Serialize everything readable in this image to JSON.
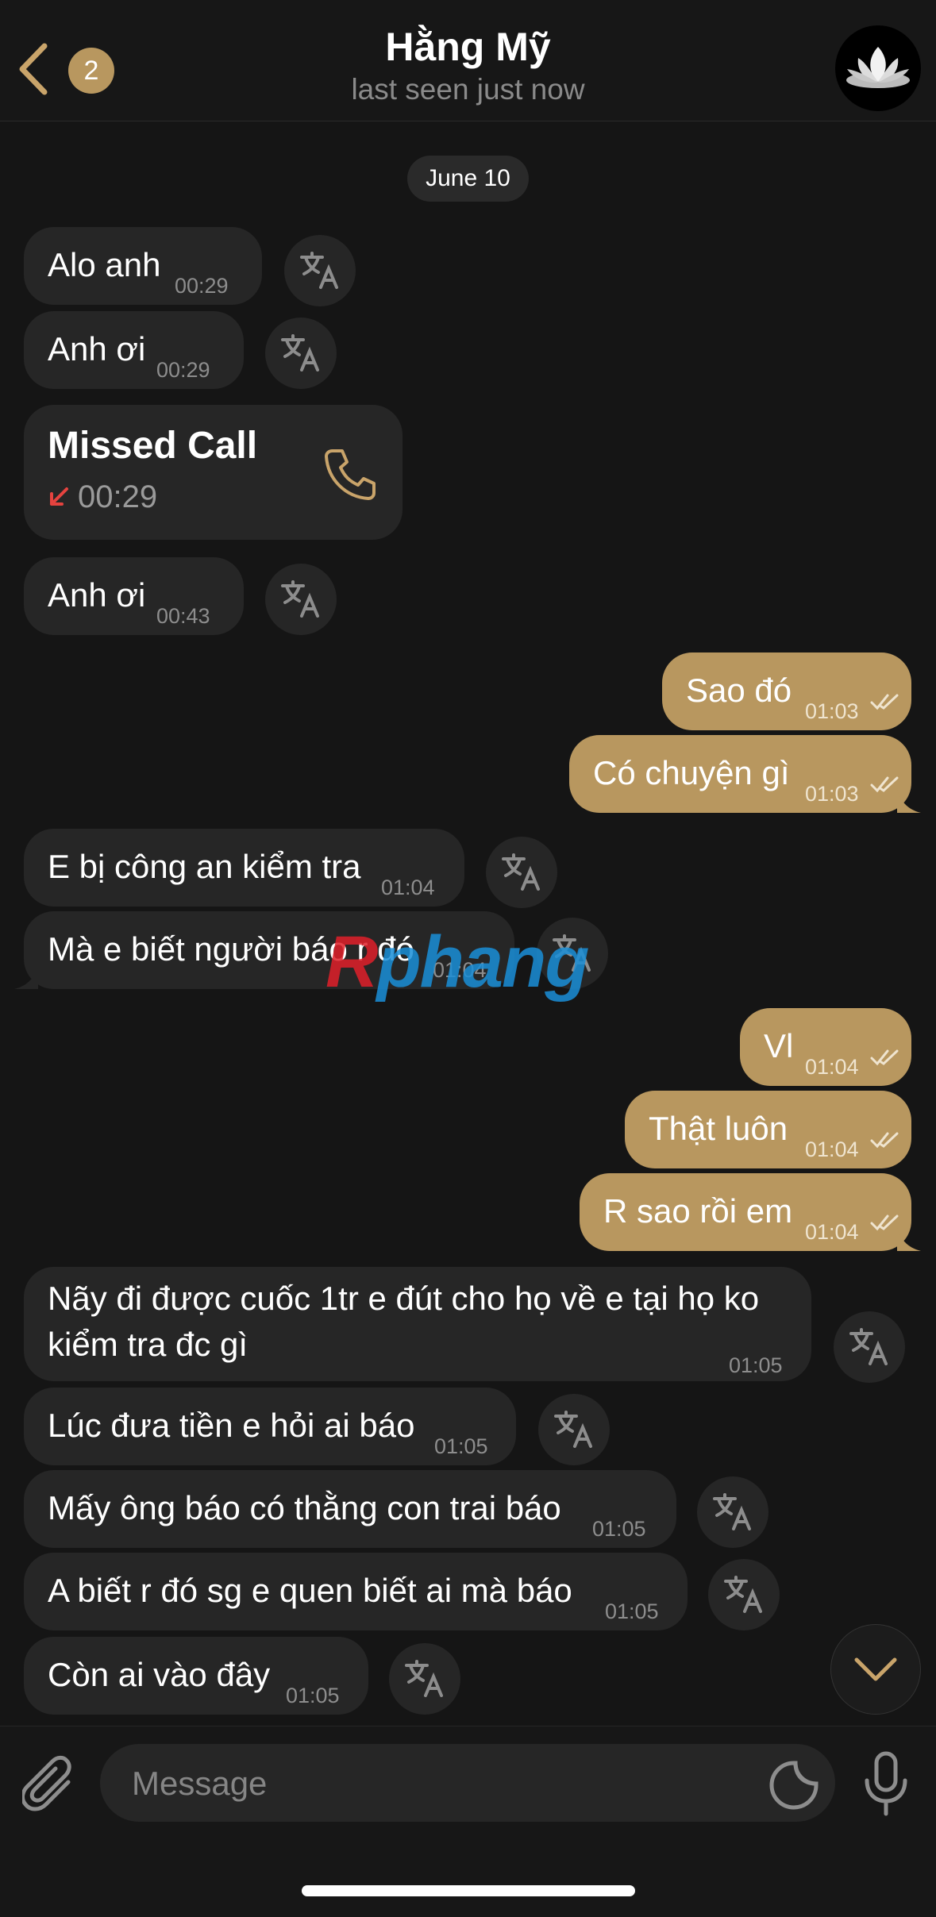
{
  "header": {
    "back_badge": "2",
    "title": "Hằng Mỹ",
    "subtitle": "last seen just now"
  },
  "date_separator": "June 10",
  "messages": [
    {
      "dir": "in",
      "text": "Alo anh",
      "time": "00:29"
    },
    {
      "dir": "in",
      "text": "Anh ơi",
      "time": "00:29"
    },
    {
      "dir": "in",
      "type": "call",
      "title": "Missed Call",
      "time": "00:29"
    },
    {
      "dir": "in",
      "text": "Anh ơi",
      "time": "00:43"
    },
    {
      "dir": "out",
      "text": "Sao đó",
      "time": "01:03"
    },
    {
      "dir": "out",
      "text": "Có chuyện gì",
      "time": "01:03"
    },
    {
      "dir": "in",
      "text": "E bị công an kiểm tra",
      "time": "01:04"
    },
    {
      "dir": "in",
      "text": "Mà e biết người báo r đó",
      "time": "01:04"
    },
    {
      "dir": "out",
      "text": "Vl",
      "time": "01:04"
    },
    {
      "dir": "out",
      "text": "Thật luôn",
      "time": "01:04"
    },
    {
      "dir": "out",
      "text": "R sao rồi em",
      "time": "01:04"
    },
    {
      "dir": "in",
      "text_line1": "Nãy đi được cuốc 1tr e đút cho họ về e tại họ ko",
      "text_line2": "kiểm tra đc gì",
      "time": "01:05"
    },
    {
      "dir": "in",
      "text": "Lúc đưa tiền e hỏi ai báo",
      "time": "01:05"
    },
    {
      "dir": "in",
      "text": "Mấy ông báo có thằng con trai báo",
      "time": "01:05"
    },
    {
      "dir": "in",
      "text": "A biết r đó sg e quen biết ai mà báo",
      "time": "01:05"
    },
    {
      "dir": "in",
      "text": "Còn ai vào đây",
      "time": "01:05"
    }
  ],
  "watermark": {
    "part1": "R",
    "part2": "phang"
  },
  "composer": {
    "placeholder": "Message"
  },
  "colors": {
    "background": "#151515",
    "incoming": "#262626",
    "outgoing": "#b8975f",
    "accent": "#c9a46a"
  },
  "icons": [
    "chevron-left-icon",
    "translate-icon",
    "phone-icon",
    "missed-arrow-icon",
    "double-check-icon",
    "chevron-down-icon",
    "paperclip-icon",
    "sticker-icon",
    "microphone-icon",
    "lotus-icon"
  ]
}
